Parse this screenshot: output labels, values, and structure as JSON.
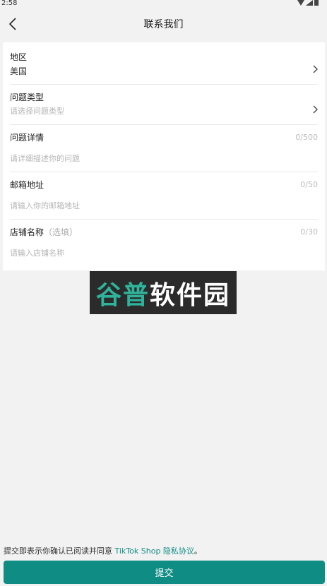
{
  "status_bar": {
    "time": "2:58"
  },
  "header": {
    "title": "联系我们"
  },
  "form": {
    "region": {
      "label": "地区",
      "value": "美国"
    },
    "issue_type": {
      "label": "问题类型",
      "placeholder": "请选择问题类型"
    },
    "issue_detail": {
      "label": "问题详情",
      "counter": "0/500",
      "placeholder": "请详细描述你的问题"
    },
    "email": {
      "label": "邮箱地址",
      "counter": "0/50",
      "placeholder": "请输入你的邮箱地址"
    },
    "shop_name": {
      "label": "店铺名称",
      "optional": "（选填）",
      "counter": "0/30",
      "placeholder": "请输入店铺名称"
    }
  },
  "watermark": {
    "text_accent": "谷普",
    "text_rest": "软件园"
  },
  "footer": {
    "agreement_prefix": "提交即表示你确认已阅读并同意 ",
    "agreement_link": "TikTok Shop 隐私协议",
    "agreement_suffix": "。",
    "submit_label": "提交"
  },
  "colors": {
    "accent": "#0f8c84",
    "link": "#138e86",
    "background": "#f2f2f2"
  },
  "icons": [
    "back-icon",
    "chevron-right-icon",
    "wifi-icon",
    "signal-icon",
    "battery-icon"
  ]
}
